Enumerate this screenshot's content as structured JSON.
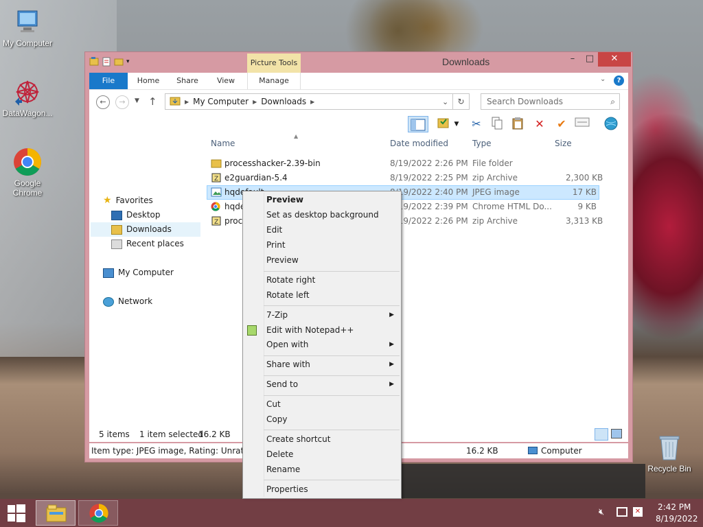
{
  "desktop": {
    "icons": [
      {
        "label": "My Computer",
        "icon": "my-computer-icon"
      },
      {
        "label": "DataWagon...",
        "icon": "datawagon-icon"
      },
      {
        "label": "Google Chrome",
        "icon": "chrome-icon"
      },
      {
        "label": "Recycle Bin",
        "icon": "recycle-bin-icon"
      }
    ]
  },
  "window": {
    "title": "Downloads",
    "context_tab": "Picture Tools",
    "controls": {
      "minimize": "–",
      "maximize": "□",
      "close": "✕"
    },
    "ribbon_tabs": [
      "File",
      "Home",
      "Share",
      "View",
      "Manage"
    ],
    "address": {
      "segments": [
        "My Computer",
        "Downloads"
      ]
    },
    "search": {
      "placeholder": "Search Downloads"
    },
    "columns": [
      "Name",
      "Date modified",
      "Type",
      "Size"
    ],
    "nav": {
      "favorites": "Favorites",
      "items": [
        "Desktop",
        "Downloads",
        "Recent places"
      ],
      "computer": "My Computer",
      "network": "Network"
    },
    "files": [
      {
        "name": "processhacker-2.39-bin",
        "date": "8/19/2022 2:26 PM",
        "type": "File folder",
        "size": "",
        "icon": "folder-icon"
      },
      {
        "name": "e2guardian-5.4",
        "date": "8/19/2022 2:25 PM",
        "type": "zip Archive",
        "size": "2,300 KB",
        "icon": "zip-icon"
      },
      {
        "name": "hqdefault",
        "date": "8/19/2022 2:40 PM",
        "type": "JPEG image",
        "size": "17 KB",
        "icon": "jpeg-icon"
      },
      {
        "name": "hqde",
        "date": "8/19/2022 2:39 PM",
        "type": "Chrome HTML Do...",
        "size": "9 KB",
        "icon": "chrome-file-icon"
      },
      {
        "name": "proc",
        "date": "8/19/2022 2:26 PM",
        "type": "zip Archive",
        "size": "3,313 KB",
        "icon": "zip-icon"
      }
    ],
    "status": {
      "items": "5 items",
      "selected": "1 item selected",
      "selected_size": "16.2 KB"
    },
    "details": {
      "item_type": "Item type: JPEG image, Rating: Unrated, Di",
      "size": "16.2 KB",
      "location": "Computer"
    }
  },
  "context_menu": {
    "items": [
      {
        "label": "Preview",
        "bold": true
      },
      {
        "label": "Set as desktop background"
      },
      {
        "label": "Edit"
      },
      {
        "label": "Print"
      },
      {
        "label": "Preview"
      },
      {
        "label": "Rotate right"
      },
      {
        "label": "Rotate left"
      },
      {
        "label": "7-Zip",
        "submenu": true
      },
      {
        "label": "Edit with Notepad++",
        "icon": "notepadpp-icon"
      },
      {
        "label": "Open with",
        "submenu": true
      },
      {
        "label": "Share with",
        "submenu": true
      },
      {
        "label": "Send to",
        "submenu": true
      },
      {
        "label": "Cut"
      },
      {
        "label": "Copy"
      },
      {
        "label": "Create shortcut"
      },
      {
        "label": "Delete"
      },
      {
        "label": "Rename"
      },
      {
        "label": "Properties"
      }
    ]
  },
  "taskbar": {
    "clock": {
      "time": "2:42 PM",
      "date": "8/19/2022"
    }
  },
  "colors": {
    "window_frame": "#d69aa3",
    "ribbon_file": "#1979ca",
    "selection": "#cce8ff",
    "taskbar": "#783c46"
  }
}
